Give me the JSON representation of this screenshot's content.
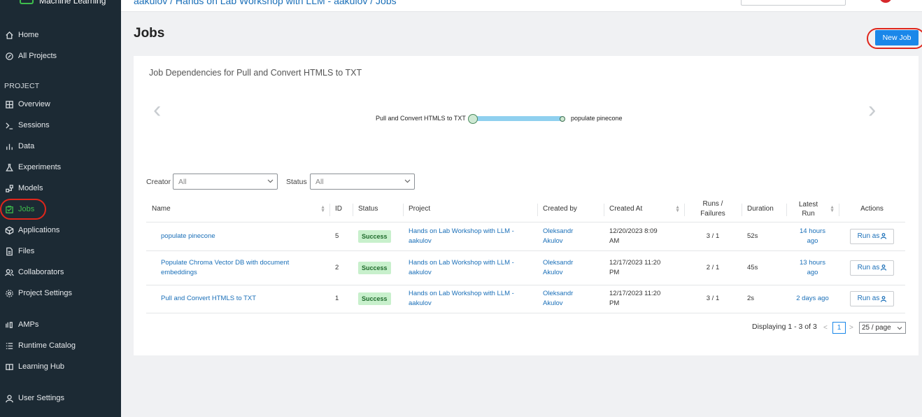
{
  "sidebar": {
    "brand": "Machine Learning",
    "top_items": [
      {
        "label": "Home",
        "icon": "home-icon"
      },
      {
        "label": "All Projects",
        "icon": "projects-icon"
      }
    ],
    "project_section": "PROJECT",
    "project_items": [
      {
        "label": "Overview",
        "icon": "overview-icon"
      },
      {
        "label": "Sessions",
        "icon": "terminal-icon"
      },
      {
        "label": "Data",
        "icon": "bar-chart-icon"
      },
      {
        "label": "Experiments",
        "icon": "flask-icon"
      },
      {
        "label": "Models",
        "icon": "models-icon"
      },
      {
        "label": "Jobs",
        "icon": "jobs-icon",
        "active": true
      },
      {
        "label": "Applications",
        "icon": "applications-icon"
      },
      {
        "label": "Files",
        "icon": "file-icon"
      },
      {
        "label": "Collaborators",
        "icon": "users-icon"
      },
      {
        "label": "Project Settings",
        "icon": "gear-icon"
      }
    ],
    "bottom_items": [
      {
        "label": "AMPs",
        "icon": "amps-icon"
      },
      {
        "label": "Runtime Catalog",
        "icon": "list-icon"
      },
      {
        "label": "Learning Hub",
        "icon": "book-icon"
      }
    ],
    "user_settings": {
      "label": "User Settings",
      "icon": "user-icon"
    },
    "active_color": "#3ebd4c"
  },
  "header": {
    "breadcrumb": "aakulov  /  Hands on Lab Workshop with LLM - aakulov  /  Jobs"
  },
  "page": {
    "title": "Jobs",
    "new_job_label": "New Job"
  },
  "dependencies": {
    "title": "Job Dependencies for Pull and Convert HTMLS to TXT",
    "source_node": "Pull and Convert HTMLS to TXT",
    "target_node": "populate pinecone",
    "prev_icon": "chevron-left-icon",
    "next_icon": "chevron-right-icon"
  },
  "filters": {
    "creator_label": "Creator",
    "creator_value": "All",
    "status_label": "Status",
    "status_value": "All"
  },
  "table": {
    "headers": {
      "name": "Name",
      "id": "ID",
      "status": "Status",
      "project": "Project",
      "created_by": "Created by",
      "created_at": "Created At",
      "runs_failures": "Runs / Failures",
      "duration": "Duration",
      "latest_run": "Latest Run",
      "actions": "Actions"
    },
    "rows": [
      {
        "name": "populate pinecone",
        "id": "5",
        "status": "Success",
        "project": "Hands on Lab Workshop with LLM - aakulov",
        "created_by": "Oleksandr Akulov",
        "created_at": "12/20/2023 8:09 AM",
        "runs_failures": "3 / 1",
        "duration": "52s",
        "latest_run": "14 hours ago",
        "action": "Run as"
      },
      {
        "name": "Populate Chroma Vector DB with document embeddings",
        "id": "2",
        "status": "Success",
        "project": "Hands on Lab Workshop with LLM - aakulov",
        "created_by": "Oleksandr Akulov",
        "created_at": "12/17/2023 11:20 PM",
        "runs_failures": "2 / 1",
        "duration": "45s",
        "latest_run": "13 hours ago",
        "action": "Run as"
      },
      {
        "name": "Pull and Convert HTMLS to TXT",
        "id": "1",
        "status": "Success",
        "project": "Hands on Lab Workshop with LLM - aakulov",
        "created_by": "Oleksandr Akulov",
        "created_at": "12/17/2023 11:20 PM",
        "runs_failures": "3 / 1",
        "duration": "2s",
        "latest_run": "2 days ago",
        "action": "Run as"
      }
    ]
  },
  "pagination": {
    "summary": "Displaying 1 - 3 of 3",
    "current_page": "1",
    "page_size": "25 / page"
  },
  "colors": {
    "accent": "#1a87e9",
    "link": "#1a6fb8",
    "success_bg": "#c8f0cc",
    "highlight_ring": "#e0261b",
    "sidebar_bg": "#1c2a34"
  }
}
